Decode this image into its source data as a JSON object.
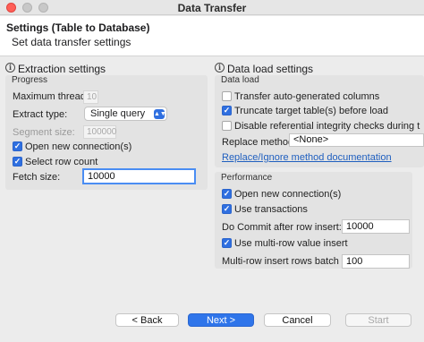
{
  "window": {
    "title": "Data Transfer"
  },
  "banner": {
    "title": "Settings (Table to Database)",
    "description": "Set data transfer settings"
  },
  "extraction": {
    "title": "Extraction settings",
    "group_label": "Progress",
    "max_threads_label": "Maximum threads:",
    "max_threads_value": "10",
    "extract_type_label": "Extract type:",
    "extract_type_value": "Single query",
    "segment_size_label": "Segment size:",
    "segment_size_value": "100000",
    "open_new_connections_label": "Open new connection(s)",
    "select_row_count_label": "Select row count",
    "fetch_size_label": "Fetch size:",
    "fetch_size_value": "10000"
  },
  "data_load": {
    "title": "Data load settings",
    "group_label": "Data load",
    "transfer_auto_label": "Transfer auto-generated columns",
    "truncate_label": "Truncate target table(s) before load",
    "disable_integrity_label": "Disable referential integrity checks during the tra",
    "replace_method_label": "Replace method:",
    "replace_method_value": "<None>",
    "replace_doc_link": "Replace/Ignore method documentation"
  },
  "performance": {
    "group_label": "Performance",
    "open_new_connections_label": "Open new connection(s)",
    "use_transactions_label": "Use transactions",
    "commit_label": "Do Commit after row insert:",
    "commit_value": "10000",
    "multi_row_label": "Use multi-row value insert",
    "batch_size_label": "Multi-row insert rows batch size:",
    "batch_size_value": "100"
  },
  "buttons": {
    "back": "< Back",
    "next": "Next >",
    "cancel": "Cancel",
    "start": "Start"
  },
  "colors": {
    "accent": "#2f75ea",
    "close": "#ff5f57",
    "link": "#1f5fbf"
  }
}
